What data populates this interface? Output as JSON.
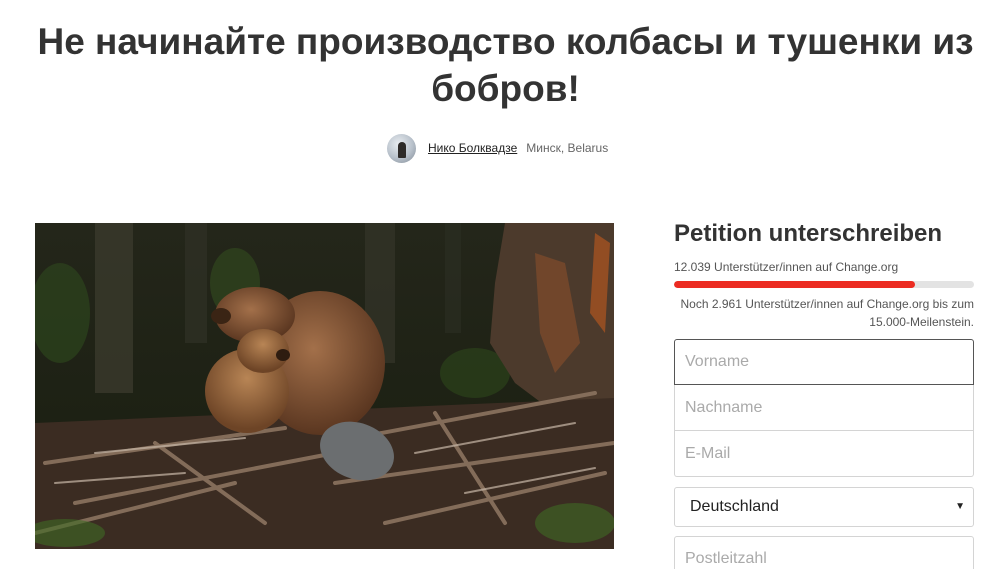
{
  "petition": {
    "title": "Не начинайте производство колбасы и тушенки из бобров!"
  },
  "author": {
    "name": "Нико Болквадзе",
    "location": "Минск, Belarus"
  },
  "sign": {
    "heading": "Petition unterschreiben",
    "supporters_text": "12.039 Unterstützer/innen auf Change.org",
    "progress_fraction": 0.8026,
    "remaining_text": "Noch 2.961 Unterstützer/innen auf Change.org bis zum 15.000-Meilenstein.",
    "progress_color": "#ec2c22"
  },
  "form": {
    "first_name_placeholder": "Vorname",
    "last_name_placeholder": "Nachname",
    "email_placeholder": "E-Mail",
    "country_selected": "Deutschland",
    "postal_placeholder": "Postleitzahl"
  },
  "icons": {
    "dropdown": "chevron-down-icon"
  }
}
